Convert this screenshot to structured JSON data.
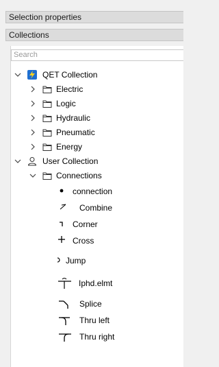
{
  "header": {
    "selection_properties": "Selection properties",
    "collections": "Collections"
  },
  "search": {
    "placeholder": "Search"
  },
  "tree": {
    "qet": {
      "label": "QET Collection",
      "children": [
        "Electric",
        "Logic",
        "Hydraulic",
        "Pneumatic",
        "Energy"
      ]
    },
    "user": {
      "label": "User Collection",
      "connections": {
        "label": "Connections",
        "elements": [
          "connection",
          "Combine",
          "Corner",
          "Cross",
          "Jump",
          "Iphd.elmt",
          "Splice",
          "Thru left",
          "Thru right"
        ]
      }
    }
  },
  "colors": {
    "qet_icon": "#1f6fd1",
    "qet_bolt": "#ffd21f"
  }
}
